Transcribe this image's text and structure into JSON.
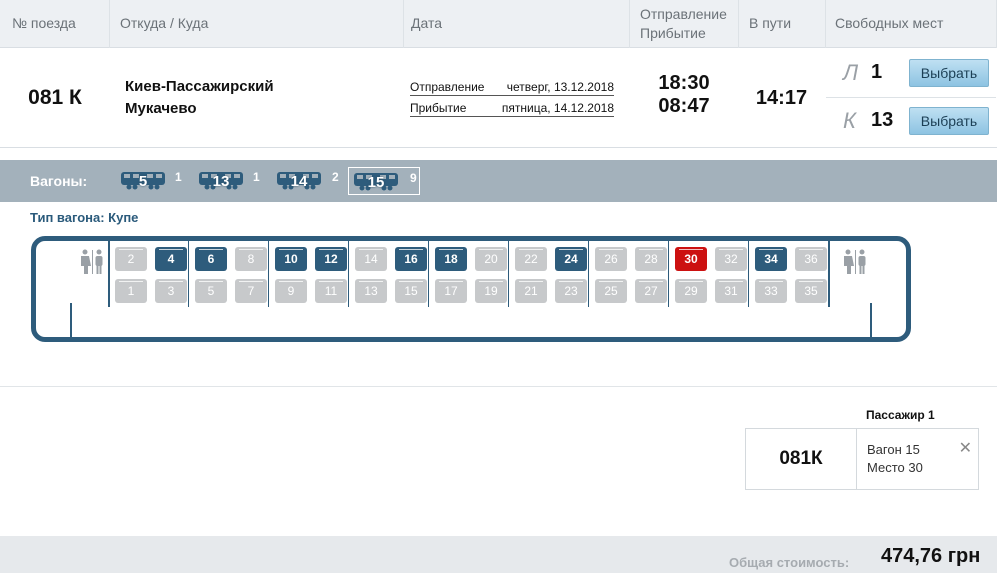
{
  "header": {
    "train_no": "№ поезда",
    "route": "Откуда / Куда",
    "date": "Дата",
    "departure": "Отправление",
    "arrival": "Прибытие",
    "duration": "В пути",
    "free_seats": "Свободных мест"
  },
  "train": {
    "number": "081 К",
    "from": "Киев-Пассажирский",
    "to": "Мукачево",
    "dep_label": "Отправление",
    "dep_date": "четверг, 13.12.2018",
    "arr_label": "Прибытие",
    "arr_date": "пятница, 14.12.2018",
    "dep_time": "18:30",
    "arr_time": "08:47",
    "duration": "14:17",
    "classes": [
      {
        "letter": "Л",
        "count": "1",
        "button": "Выбрать"
      },
      {
        "letter": "К",
        "count": "13",
        "button": "Выбрать"
      }
    ]
  },
  "wagons": {
    "label": "Вагоны:",
    "items": [
      {
        "number": "5",
        "free": "1",
        "selected": false
      },
      {
        "number": "13",
        "free": "1",
        "selected": false
      },
      {
        "number": "14",
        "free": "2",
        "selected": false
      },
      {
        "number": "15",
        "free": "9",
        "selected": true
      }
    ]
  },
  "wagon_type": "Тип вагона: Купе",
  "seats": {
    "upper": [
      "2",
      "4",
      "6",
      "8",
      "10",
      "12",
      "14",
      "16",
      "18",
      "20",
      "22",
      "24",
      "26",
      "28",
      "30",
      "32",
      "34",
      "36"
    ],
    "lower": [
      "1",
      "3",
      "5",
      "7",
      "9",
      "11",
      "13",
      "15",
      "17",
      "19",
      "21",
      "23",
      "25",
      "27",
      "29",
      "31",
      "33",
      "35"
    ],
    "free": [
      "4",
      "6",
      "10",
      "12",
      "16",
      "18",
      "24",
      "30",
      "34"
    ],
    "selected": "30"
  },
  "passenger": {
    "title": "Пассажир 1",
    "train": "081К",
    "wagon": "Вагон 15",
    "seat": "Место 30",
    "close": "✕"
  },
  "total": {
    "label": "Общая стоимость:",
    "value": "474,76 грн"
  },
  "colors": {
    "accent": "#2e5c7c",
    "selected_seat": "#cc1111",
    "occupied_seat": "#c7c9cb",
    "wagon_bar": "#a3b1bb"
  }
}
